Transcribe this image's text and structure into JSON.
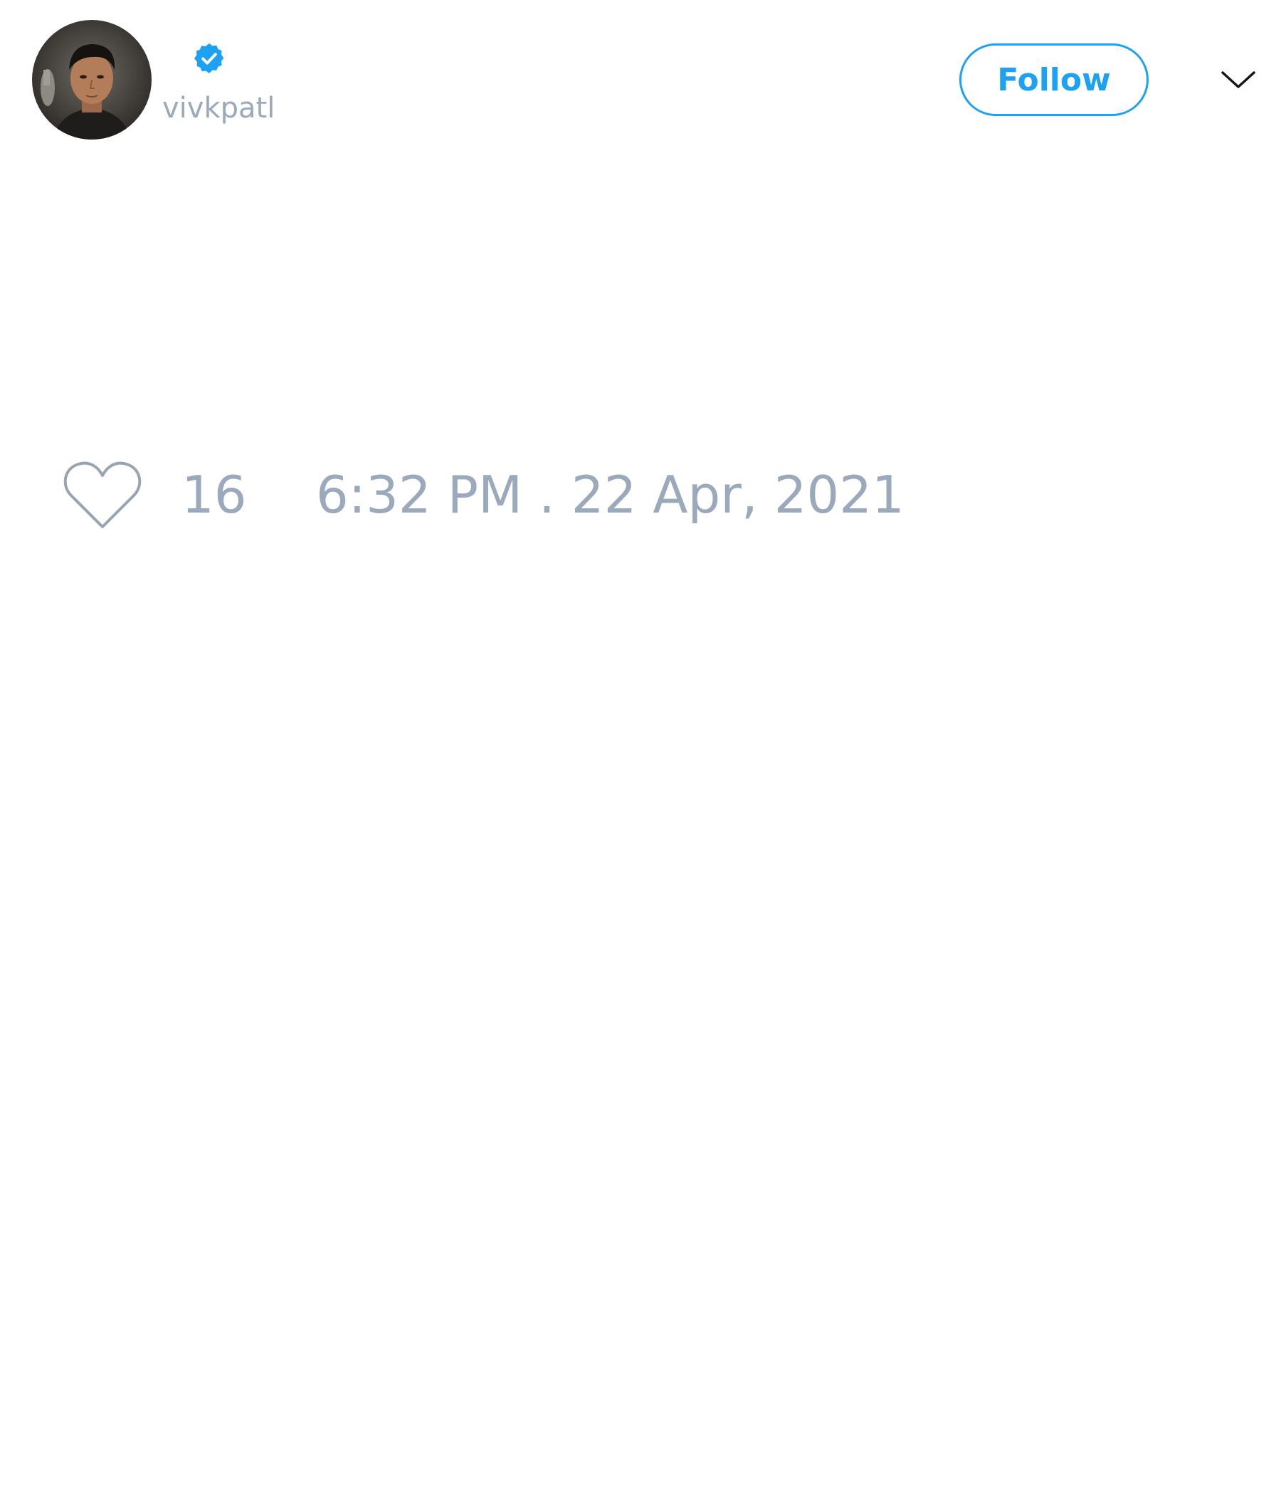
{
  "author": {
    "username": "vivkpatl",
    "verified": true,
    "avatar_icon": "profile-photo"
  },
  "header": {
    "follow_label": "Follow",
    "menu_icon": "chevron-down-icon"
  },
  "stats": {
    "like_icon": "heart-outline-icon",
    "like_count": "16",
    "timestamp": "6:32 PM . 22 Apr, 2021"
  },
  "colors": {
    "accent": "#1da1f2",
    "muted_text": "#9aa9bb",
    "icon_stroke": "#9aa4b0",
    "chevron": "#14171a",
    "background": "#ffffff"
  }
}
